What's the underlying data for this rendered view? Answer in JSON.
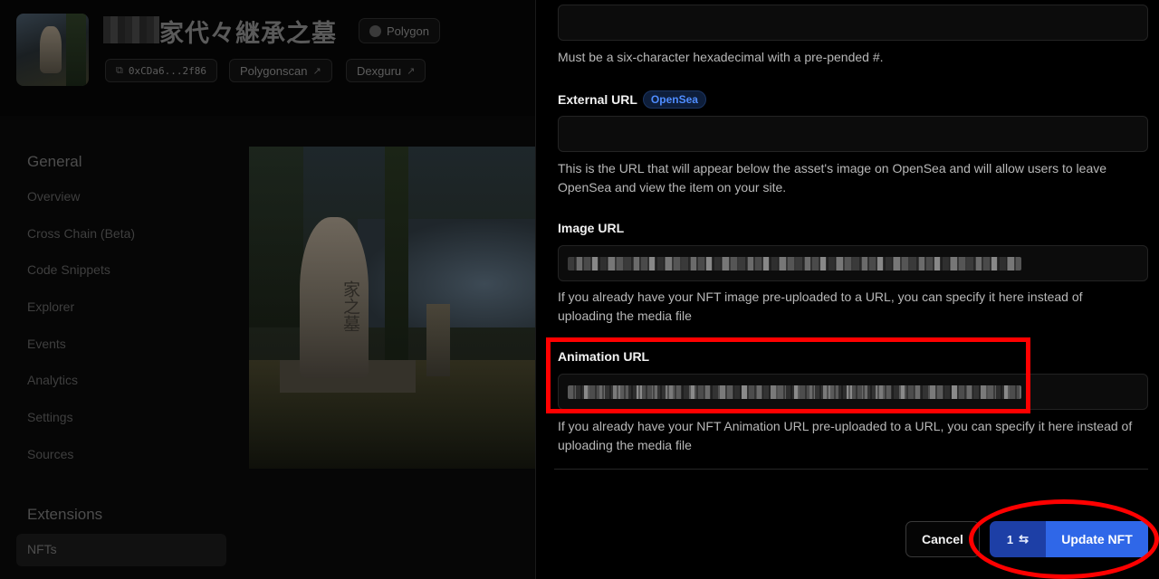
{
  "project": {
    "title": "家代々継承之墓",
    "network": "Polygon",
    "address": "0xCDa6...2f86",
    "links": [
      "Polygonscan",
      "Dexguru"
    ]
  },
  "sidebar": {
    "general_heading": "General",
    "general_items": [
      "Overview",
      "Cross Chain (Beta)",
      "Code Snippets",
      "Explorer",
      "Events",
      "Analytics",
      "Settings",
      "Sources"
    ],
    "extensions_heading": "Extensions",
    "extensions_items": [
      "NFTs"
    ]
  },
  "nft_image": {
    "engraving": "家之墓"
  },
  "form": {
    "color_help": "Must be a six-character hexadecimal with a pre-pended #.",
    "external_url": {
      "label": "External URL",
      "badge": "OpenSea",
      "value": "",
      "help": "This is the URL that will appear below the asset's image on OpenSea and will allow users to leave OpenSea and view the item on your site."
    },
    "image_url": {
      "label": "Image URL",
      "help": "If you already have your NFT image pre-uploaded to a URL, you can specify it here instead of uploading the media file"
    },
    "animation_url": {
      "label": "Animation URL",
      "help": "If you already have your NFT Animation URL pre-uploaded to a URL, you can specify it here instead of uploading the media file"
    }
  },
  "actions": {
    "cancel": "Cancel",
    "tx_count": "1",
    "update": "Update NFT"
  },
  "colors": {
    "accent": "#2f67e8",
    "highlight": "#ff0000",
    "badge": "#4f8dff"
  }
}
